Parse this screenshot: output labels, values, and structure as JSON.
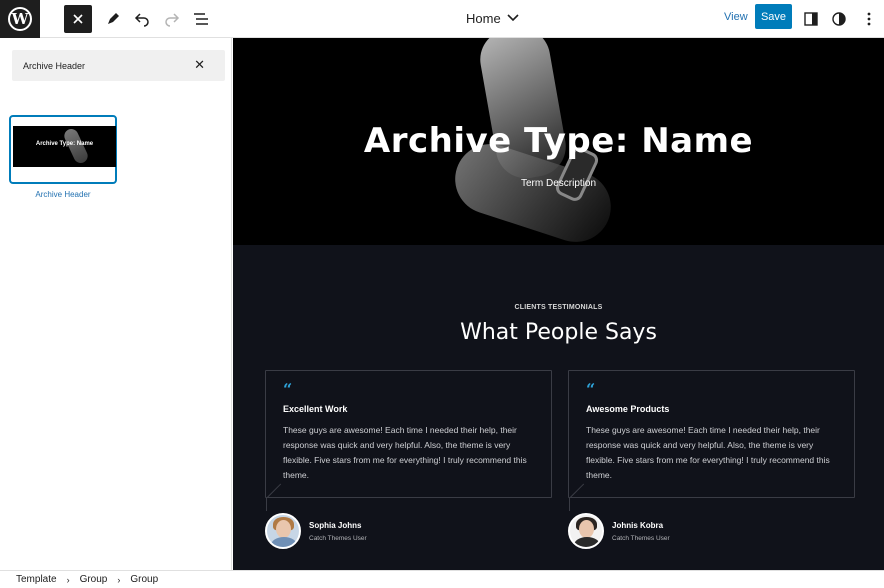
{
  "toolbar": {
    "logo_letter": "W",
    "document_title": "Home",
    "view_label": "View",
    "save_label": "Save"
  },
  "sidebar": {
    "search_value": "Archive Header",
    "pattern": {
      "label": "Archive Header",
      "thumb_text": "Archive Type: Name"
    }
  },
  "canvas": {
    "hero": {
      "title": "Archive Type: Name",
      "description": "Term Description"
    },
    "testimonials": {
      "subtitle": "CLIENTS TESTIMONIALS",
      "title": "What People Says",
      "quote_mark": "“",
      "items": [
        {
          "title": "Excellent Work",
          "text": "These guys are awesome! Each time I needed their help, their response was quick and very helpful. Also, the theme is very flexible. Five stars from me for everything! I truly recommend this theme.",
          "author": "Sophia Johns",
          "role": "Catch Themes User"
        },
        {
          "title": "Awesome Products",
          "text": "These guys are awesome! Each time I needed their help, their response was quick and very helpful. Also, the theme is very flexible. Five stars from me for everything! I truly recommend this theme.",
          "author": "Johnis Kobra",
          "role": "Catch Themes User"
        }
      ]
    }
  },
  "breadcrumb": {
    "items": [
      "Template",
      "Group",
      "Group"
    ],
    "separator": "›"
  },
  "colors": {
    "accent": "#007cba",
    "canvas_bg": "#10121a",
    "quote": "#2ea3d9"
  }
}
